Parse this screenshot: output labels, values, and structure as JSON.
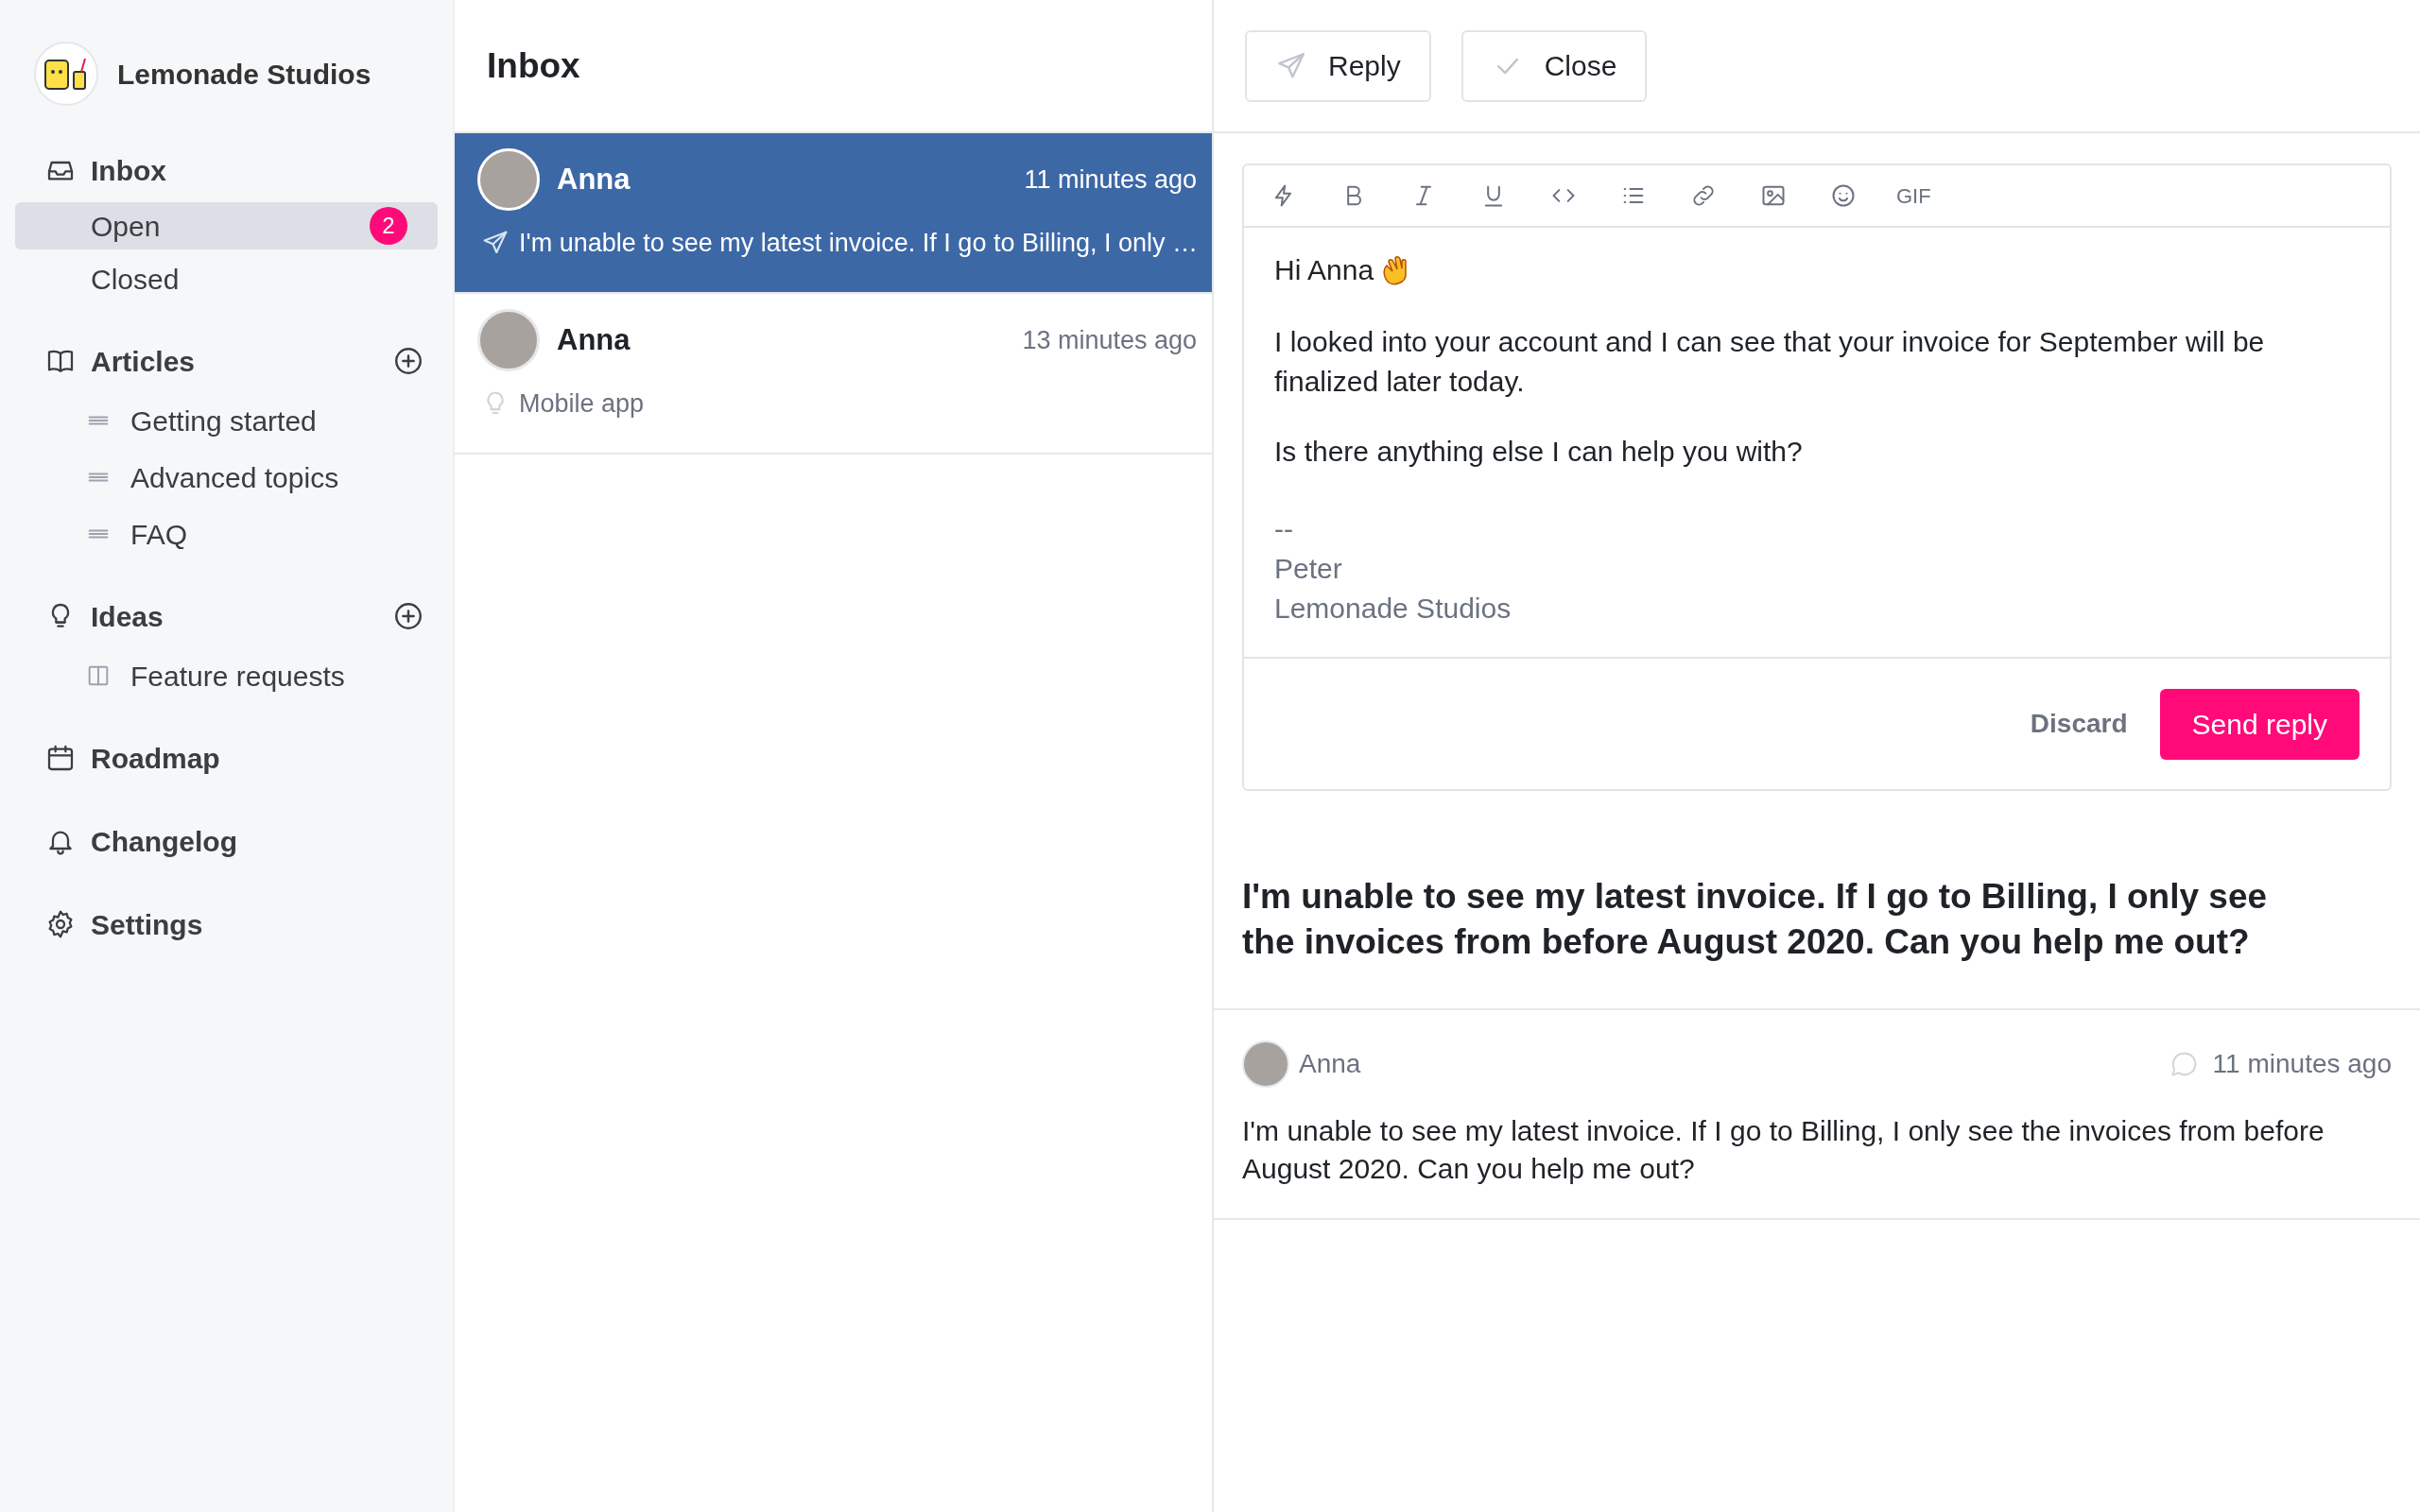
{
  "sidebar": {
    "brand": "Lemonade Studios",
    "sections": [
      {
        "label": "Inbox",
        "items": [
          {
            "label": "Open",
            "selected": true,
            "badge": "2"
          },
          {
            "label": "Closed",
            "selected": false
          }
        ]
      },
      {
        "label": "Articles",
        "items": [
          {
            "label": "Getting started",
            "selected": false
          },
          {
            "label": "Advanced topics",
            "selected": false
          },
          {
            "label": "FAQ",
            "selected": false
          }
        ]
      },
      {
        "label": "Ideas",
        "items": [
          {
            "label": "Feature requests",
            "selected": false
          }
        ]
      },
      {
        "label": "Roadmap"
      },
      {
        "label": "Changelog"
      },
      {
        "label": "Settings"
      }
    ]
  },
  "inbox": {
    "title": "Inbox",
    "conversations": [
      {
        "name": "Anna",
        "time": "11 minutes ago",
        "preview": "I'm unable to see my latest invoice. If I go to Billing, I only …",
        "selected": true
      },
      {
        "name": "Anna",
        "time": "13 minutes ago",
        "preview": "Mobile app",
        "selected": false
      }
    ]
  },
  "actions": [
    "Reply",
    "Close"
  ],
  "editor": {
    "gif_label": "GIF",
    "greeting": "Hi Anna",
    "paragraphs": [
      "I looked into your account and I can see that your invoice for September will be finalized later today.",
      "Is there anything else I can help you with?"
    ],
    "signature": [
      "--",
      "Peter",
      "Lemonade Studios"
    ],
    "discard": "Discard",
    "send": "Send reply"
  },
  "subject": "I'm unable to see my latest invoice. If I go to Billing, I only see the invoices from before August 2020. Can you help me out?",
  "message": {
    "author": "Anna",
    "time": "11 minutes ago",
    "body": "I'm unable to see my latest invoice. If I go to Billing, I only see the invoices from before August 2020. Can you help me out?"
  }
}
